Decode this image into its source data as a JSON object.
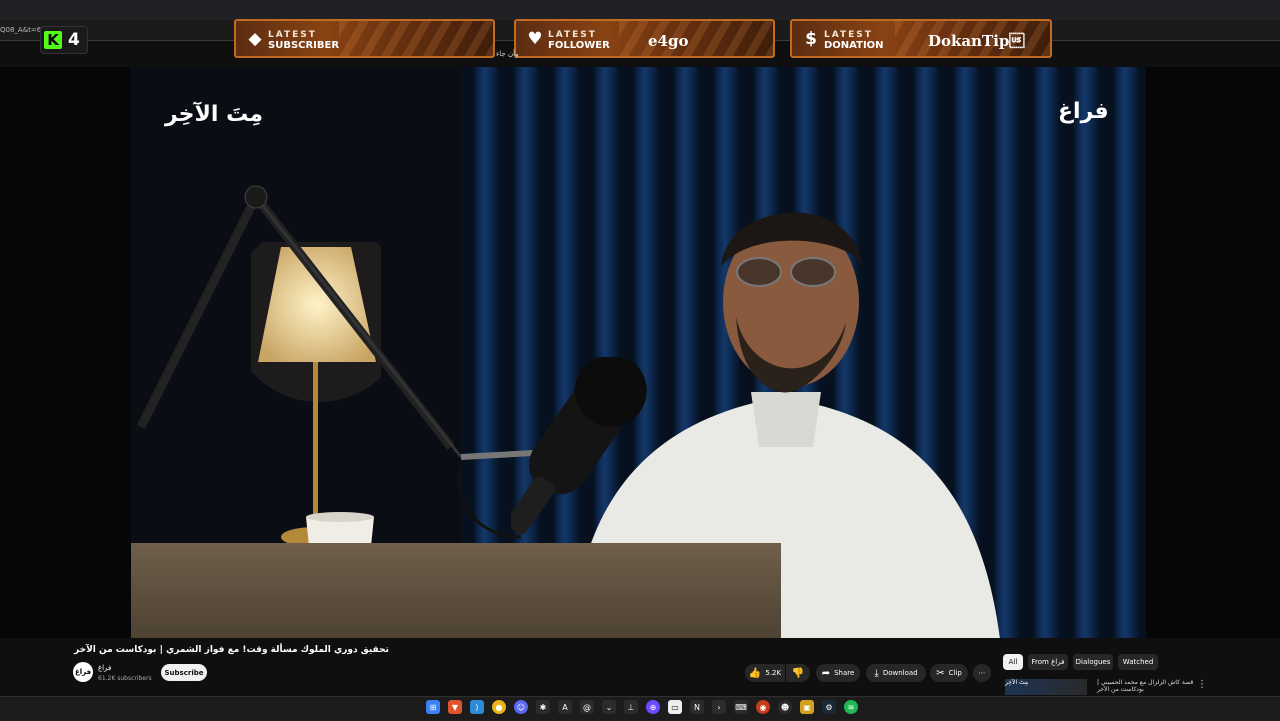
{
  "browser": {
    "url_fragment": "Q08_A&t=63",
    "small_text": "وأن جاء"
  },
  "kick": {
    "logo": "K",
    "viewers": "4"
  },
  "alerts": {
    "subscriber": {
      "icon": "diamond-icon",
      "line1": "LATEST",
      "line2": "SUBSCRIBER",
      "name": ""
    },
    "follower": {
      "icon": "heart-icon",
      "line1": "LATEST",
      "line2": "FOLLOWER",
      "name": "e4go"
    },
    "donation": {
      "icon": "dollar-icon",
      "line1": "LATEST",
      "line2": "DONATION",
      "name": "DokanTip\u001f"
    }
  },
  "video": {
    "watermark_left": "مِتَ الآخِر",
    "watermark_right": "فراغ"
  },
  "youtube": {
    "title": "تحقيق دوري الملوك مسألة وقت! مع فواز الشمري | بودكاست من الآخر",
    "channel_name": "فراغ",
    "subscribers": "61.2K subscribers",
    "avatar_text": "فراغ",
    "subscribe_label": "Subscribe",
    "likes": "5.2K",
    "share_label": "Share",
    "download_label": "Download",
    "clip_label": "Clip",
    "more_label": "⋯",
    "chips": [
      "All",
      "From فراغ",
      "Dialogues",
      "Watched"
    ],
    "recommendation": {
      "title": "قصة كاش الزلزال مع محمد الحسيني | بودكاست من الآخر",
      "thumb_text": "مِتَ الآخِر"
    }
  },
  "taskbar": {
    "icons": [
      "windows-icon",
      "brave-icon",
      "vscode-icon",
      "chrome-icon",
      "discord-icon",
      "whatsapp-icon",
      "notion-icon",
      "at-icon",
      "pin-icon",
      "proton-icon",
      "files-icon",
      "terminal-icon",
      "notepad-icon",
      "arrow-icon",
      "folder-icon",
      "obs-icon",
      "github-icon",
      "ghost-icon",
      "steam-icon",
      "spotify-icon"
    ]
  }
}
